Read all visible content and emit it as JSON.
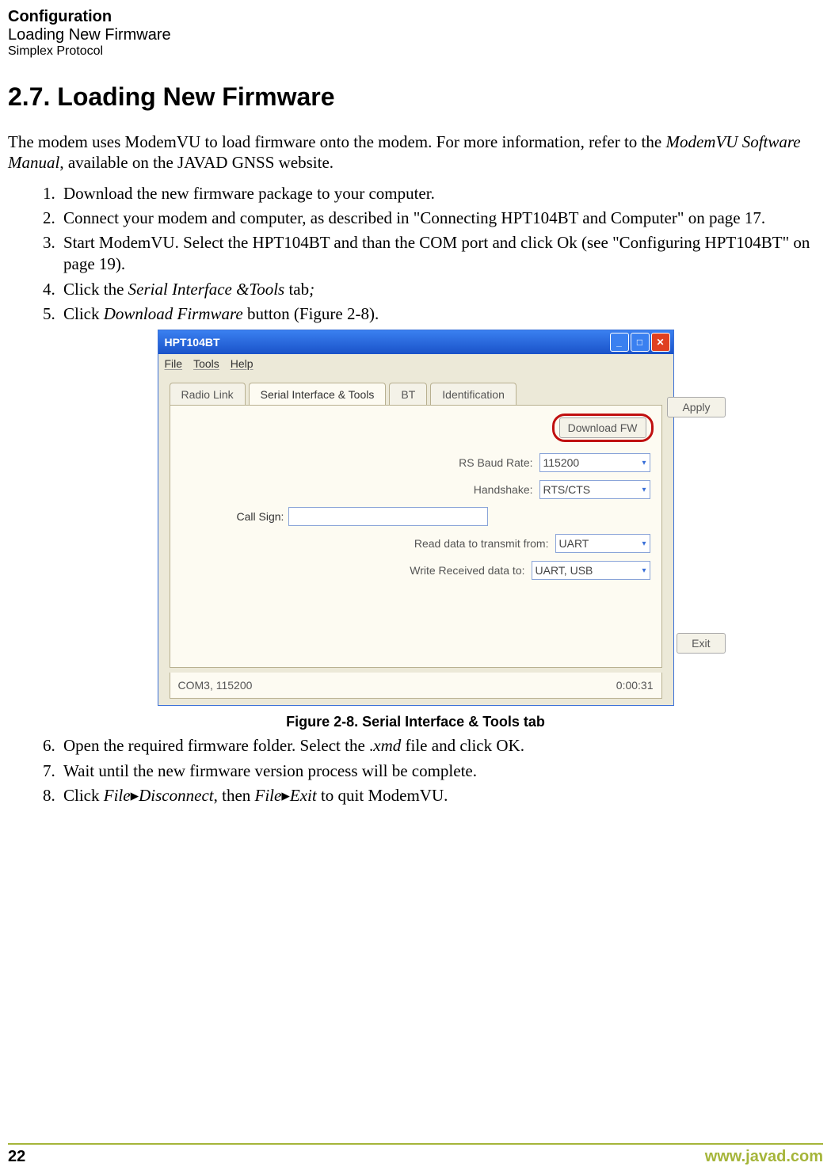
{
  "header": {
    "line1": "Configuration",
    "line2": "Loading New Firmware",
    "line3": "Simplex Protocol"
  },
  "section_title": "2.7. Loading New Firmware",
  "intro": {
    "p1a": "The modem uses ModemVU to load firmware onto the modem. For more information, refer to the ",
    "p1b": "ModemVU Software Manual",
    "p1c": ", available on the JAVAD GNSS website."
  },
  "steps": {
    "s1": "Download the new firmware package to your computer.",
    "s2": "Connect your modem and computer, as described in \"Connecting HPT104BT and Computer\" on page 17.",
    "s3": "Start ModemVU. Select the HPT104BT and than the COM port and click Ok (see \"Configuring HPT104BT\" on page 19).",
    "s4a": "Click the ",
    "s4b": "Serial Interface &Tools",
    "s4c": " tab",
    "s4d": ";",
    "s5a": "Click ",
    "s5b": "Download Firmware",
    "s5c": " button (Figure 2-8).",
    "s6a": "Open the required firmware folder. Select the .",
    "s6b": "xmd",
    "s6c": " file and click OK.",
    "s7": "Wait until the new firmware version process will be complete.",
    "s8a": "Click ",
    "s8b": "File",
    "s8c": "Disconnect",
    "s8d": ", then ",
    "s8e": "File",
    "s8f": "Exit",
    "s8g": " to quit ModemVU."
  },
  "fig_caption": "Figure 2-8. Serial Interface & Tools tab",
  "footer": {
    "page": "22",
    "url": "www.javad.com"
  },
  "screenshot": {
    "title": "HPT104BT",
    "menu": {
      "file": "File",
      "tools": "Tools",
      "help": "Help"
    },
    "tabs": {
      "radio": "Radio Link",
      "serial": "Serial Interface & Tools",
      "bt": "BT",
      "ident": "Identification"
    },
    "buttons": {
      "apply": "Apply",
      "exit": "Exit",
      "download": "Download FW"
    },
    "labels": {
      "baud": "RS Baud Rate:",
      "handshake": "Handshake:",
      "callsign": "Call Sign:",
      "read": "Read data to transmit from:",
      "write": "Write Received data to:"
    },
    "values": {
      "baud": "115200",
      "handshake": "RTS/CTS",
      "callsign": "",
      "read": "UART",
      "write": "UART, USB"
    },
    "status": {
      "left": "COM3, 115200",
      "right": "0:00:31"
    }
  }
}
